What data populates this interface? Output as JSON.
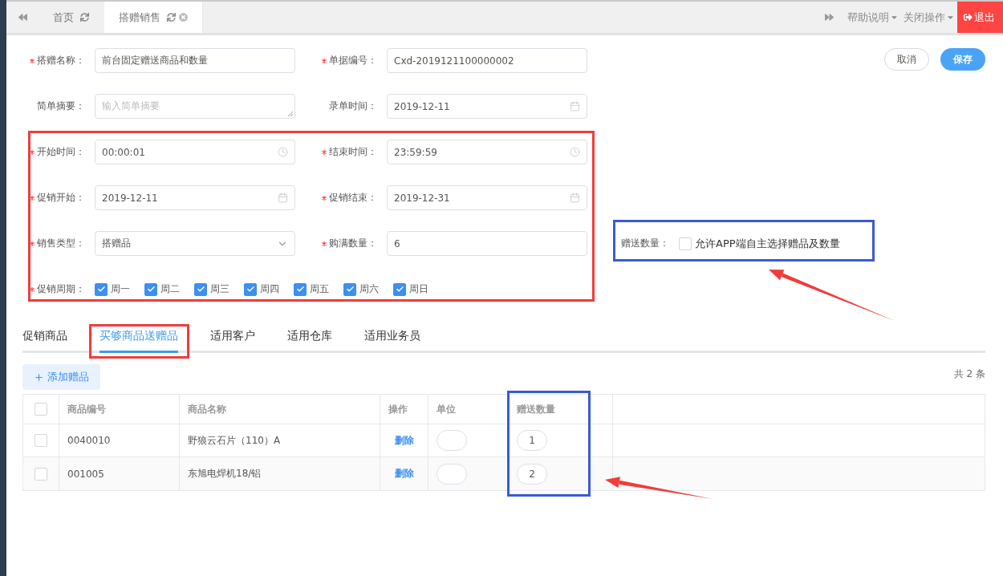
{
  "top_tabs": [
    {
      "label": "首页",
      "selected": false,
      "closable": false
    },
    {
      "label": "搭赠销售",
      "selected": true,
      "closable": true
    }
  ],
  "top_menu": [
    {
      "label": "帮助说明"
    },
    {
      "label": "关闭操作"
    }
  ],
  "logout": "退出",
  "actions": [
    {
      "label": "取消",
      "kind": "secondary"
    },
    {
      "label": "保存",
      "kind": "primary"
    }
  ],
  "form_rows": [
    {
      "fields": [
        {
          "kind": "text",
          "label": "搭赠名称：",
          "required": true,
          "value": "前台固定赠送商品和数量"
        },
        {
          "kind": "text",
          "label": "单据编号：",
          "required": true,
          "value": "Cxd-2019121100000002"
        }
      ]
    },
    {
      "fields": [
        {
          "kind": "textarea",
          "label": "简单摘要：",
          "required": false,
          "placeholder": "输入简单摘要"
        },
        {
          "kind": "date",
          "label": "录单时间：",
          "required": false,
          "value": "2019-12-11"
        }
      ]
    },
    {
      "fields": [
        {
          "kind": "time",
          "label": "开始时间：",
          "required": true,
          "value": "00:00:01"
        },
        {
          "kind": "time",
          "label": "结束时间：",
          "required": true,
          "value": "23:59:59"
        }
      ]
    },
    {
      "fields": [
        {
          "kind": "date",
          "label": "促销开始：",
          "required": true,
          "value": "2019-12-11"
        },
        {
          "kind": "date",
          "label": "促销结束：",
          "required": true,
          "value": "2019-12-31"
        }
      ]
    },
    {
      "fields": [
        {
          "kind": "select",
          "label": "销售类型：",
          "required": true,
          "value": "搭赠品"
        },
        {
          "kind": "text",
          "label": "购满数量：",
          "required": true,
          "value": "6"
        },
        {
          "kind": "checkbox",
          "label": "赠送数量：",
          "required": false,
          "option": "允许APP端自主选择赠品及数量",
          "checked": false
        }
      ]
    },
    {
      "fields": [
        {
          "kind": "checkgroup",
          "label": "促销周期：",
          "required": true,
          "options": [
            {
              "label": "周一",
              "checked": true
            },
            {
              "label": "周二",
              "checked": true
            },
            {
              "label": "周三",
              "checked": true
            },
            {
              "label": "周四",
              "checked": true
            },
            {
              "label": "周五",
              "checked": true
            },
            {
              "label": "周六",
              "checked": true
            },
            {
              "label": "周日",
              "checked": true
            }
          ]
        }
      ]
    }
  ],
  "detail_tabs": [
    {
      "label": "促销商品",
      "selected": false
    },
    {
      "label": "买够商品送赠品",
      "selected": true
    },
    {
      "label": "适用客户",
      "selected": false
    },
    {
      "label": "适用仓库",
      "selected": false
    },
    {
      "label": "适用业务员",
      "selected": false
    }
  ],
  "add_button": "添加赠品",
  "total": "共 2 条",
  "table": {
    "header_checked": false,
    "columns": [
      "商品编号",
      "商品名称",
      "操作",
      "单位",
      "赠送数量"
    ],
    "rows": [
      {
        "checked": false,
        "code": "0040010",
        "name": "野狼云石片（110）A",
        "action": "删除",
        "quantity": "1"
      },
      {
        "checked": false,
        "code": "001005",
        "name": "东旭电焊机18/铝",
        "action": "删除",
        "quantity": "2"
      }
    ]
  },
  "annotations": [
    {
      "kind": "box",
      "color": "#f03c3c"
    },
    {
      "kind": "box",
      "color": "#3a5bd0"
    },
    {
      "kind": "arrow",
      "color": "#f03c3c"
    },
    {
      "kind": "box",
      "color": "#f03c3c"
    },
    {
      "kind": "box",
      "color": "#3a5bd0"
    },
    {
      "kind": "arrow",
      "color": "#f03c3c"
    }
  ]
}
